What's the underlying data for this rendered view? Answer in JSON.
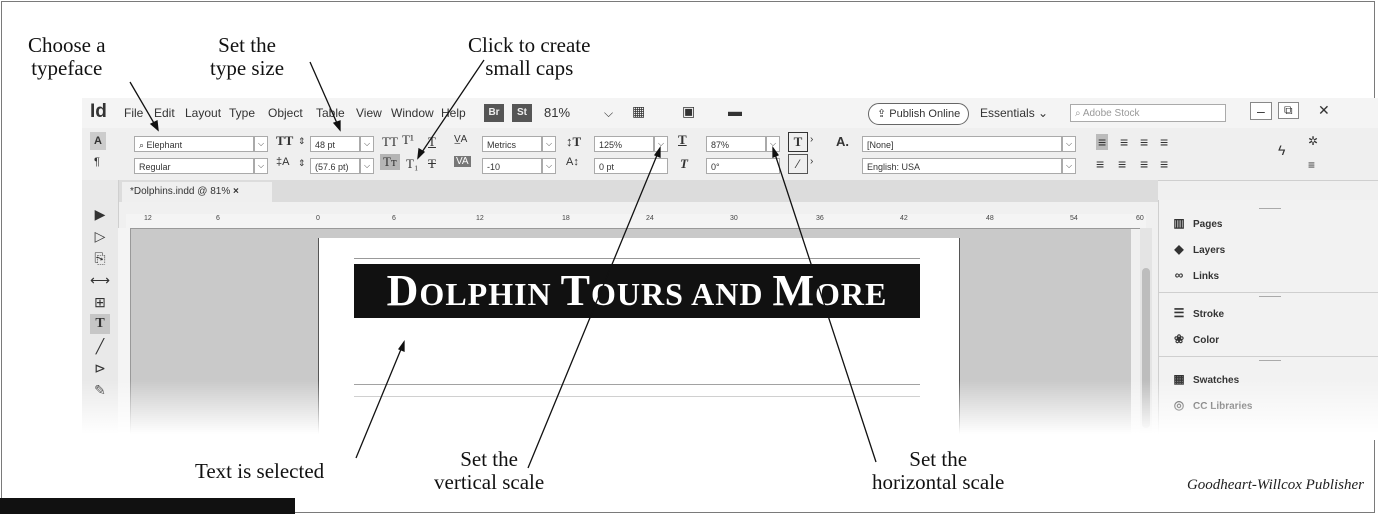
{
  "annotations": {
    "typeface": "Choose a\ntypeface",
    "type_size": "Set the\ntype size",
    "small_caps": "Click to create\nsmall caps",
    "text_selected": "Text is selected",
    "vertical_scale": "Set the\nvertical scale",
    "horizontal_scale": "Set the\nhorizontal scale"
  },
  "credit": "Goodheart-Willcox Publisher",
  "app": {
    "logo": "Id",
    "menu": [
      "File",
      "Edit",
      "Layout",
      "Type",
      "Object",
      "Table",
      "View",
      "Window",
      "Help"
    ],
    "bridge_button": "Br",
    "stock_button": "St",
    "zoom": "81%",
    "publish_online": "Publish Online",
    "workspace": "Essentials",
    "search_placeholder": "Adobe Stock"
  },
  "control_panel": {
    "font_family": "Elephant",
    "font_style": "Regular",
    "font_size": "48 pt",
    "leading": "(57.6 pt)",
    "kerning": "Metrics",
    "tracking": "-10",
    "vertical_scale": "125%",
    "horizontal_scale": "87%",
    "baseline_shift": "0 pt",
    "skew": "0°",
    "char_style": "[None]",
    "language": "English: USA"
  },
  "document": {
    "tab_title": "*Dolphins.indd @ 81%",
    "ruler_labels": [
      "12",
      "6",
      "0",
      "6",
      "12",
      "18",
      "24",
      "30",
      "36",
      "42",
      "48",
      "54",
      "60"
    ],
    "headline": {
      "caps1": "D",
      "rest1": "OLPHIN ",
      "caps2": "T",
      "rest2": "OURS AND ",
      "caps3": "M",
      "rest3": "ORE"
    }
  },
  "panels": {
    "items": [
      "Pages",
      "Layers",
      "Links",
      "Stroke",
      "Color",
      "Swatches",
      "CC Libraries"
    ]
  }
}
